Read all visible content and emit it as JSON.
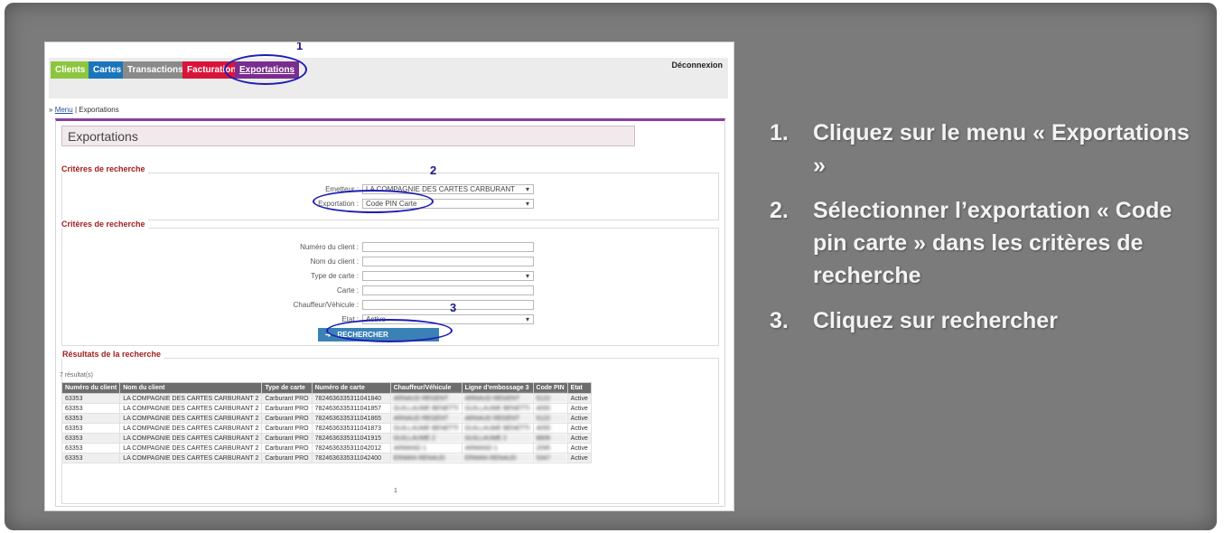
{
  "app": {
    "tabs": [
      {
        "label": "Clients",
        "color": "#8cc63f"
      },
      {
        "label": "Cartes",
        "color": "#1b75bb"
      },
      {
        "label": "Transactions",
        "color": "#8a8a8a"
      },
      {
        "label": "Facturation",
        "color": "#d9143a"
      },
      {
        "label": "Exportations",
        "color": "#7b2d8e"
      }
    ],
    "logout_label": "Déconnexion",
    "breadcrumb": {
      "menu": "Menu",
      "separator": "|",
      "current": "Exportations"
    },
    "page_title": "Exportations",
    "criteria_export": {
      "title": "Critères de recherche",
      "emetteur_label": "Emetteur :",
      "emetteur_value": "LA COMPAGNIE DES CARTES CARBURANT",
      "exportation_label": "Exportation :",
      "exportation_value": "Code PIN Carte"
    },
    "criteria_search": {
      "title": "Critères de recherche",
      "fields": [
        {
          "label": "Numéro du client :",
          "value": ""
        },
        {
          "label": "Nom du client :",
          "value": ""
        },
        {
          "label": "Type de carte :",
          "value": ""
        },
        {
          "label": "Carte :",
          "value": ""
        },
        {
          "label": "Chauffeur/Véhicule :",
          "value": ""
        },
        {
          "label": "Etat :",
          "value": "Active"
        }
      ]
    },
    "search_button": "RECHERCHER",
    "results": {
      "title": "Résultats de la recherche",
      "count": "7 résultat(s)",
      "columns": [
        "Numéro du client",
        "Nom du client",
        "Type de carte",
        "Numéro de carte",
        "Chauffeur/Véhicule",
        "Ligne d'embossage 3",
        "Code PIN",
        "Etat"
      ],
      "rows": [
        [
          "63353",
          "LA COMPAGNIE DES CARTES CARBURANT 2",
          "Carburant PRO",
          "7824636335311041840",
          "ARNAUD REGENT",
          "ARNAUD REGENT",
          "5122",
          "Active"
        ],
        [
          "63353",
          "LA COMPAGNIE DES CARTES CARBURANT 2",
          "Carburant PRO",
          "7824636335311041857",
          "GUILLAUME BENETTI",
          "GUILLAUME BENETTI",
          "4055",
          "Active"
        ],
        [
          "63353",
          "LA COMPAGNIE DES CARTES CARBURANT 2",
          "Carburant PRO",
          "7824636335311041865",
          "ARNAUD REGENT",
          "ARNAUD REGENT",
          "5122",
          "Active"
        ],
        [
          "63353",
          "LA COMPAGNIE DES CARTES CARBURANT 2",
          "Carburant PRO",
          "7824636335311041873",
          "GUILLAUME BENETTI",
          "GUILLAUME BENETTI",
          "4055",
          "Active"
        ],
        [
          "63353",
          "LA COMPAGNIE DES CARTES CARBURANT 2",
          "Carburant PRO",
          "7824636335311041915",
          "GUILLAUME 2",
          "GUILLAUME 2",
          "8806",
          "Active"
        ],
        [
          "63353",
          "LA COMPAGNIE DES CARTES CARBURANT 2",
          "Carburant PRO",
          "7824636335311042012",
          "ARMAND 1",
          "ARMAND 1",
          "2095",
          "Active"
        ],
        [
          "63353",
          "LA COMPAGNIE DES CARTES CARBURANT 2",
          "Carburant PRO",
          "7824636335311042400",
          "ERWAN RENAUD",
          "ERWAN RENAUD",
          "5347",
          "Active"
        ]
      ],
      "pager": "1"
    }
  },
  "annotations": {
    "n1": "1",
    "n2": "2",
    "n3": "3",
    "ring_color": "#1e1eb4"
  },
  "instructions": [
    {
      "n": "1.",
      "text": "Cliquez sur le menu « Exportations »"
    },
    {
      "n": "2.",
      "text": "Sélectionner l’exportation « Code pin carte » dans les critères de recherche"
    },
    {
      "n": "3.",
      "text": "Cliquez sur rechercher"
    }
  ]
}
